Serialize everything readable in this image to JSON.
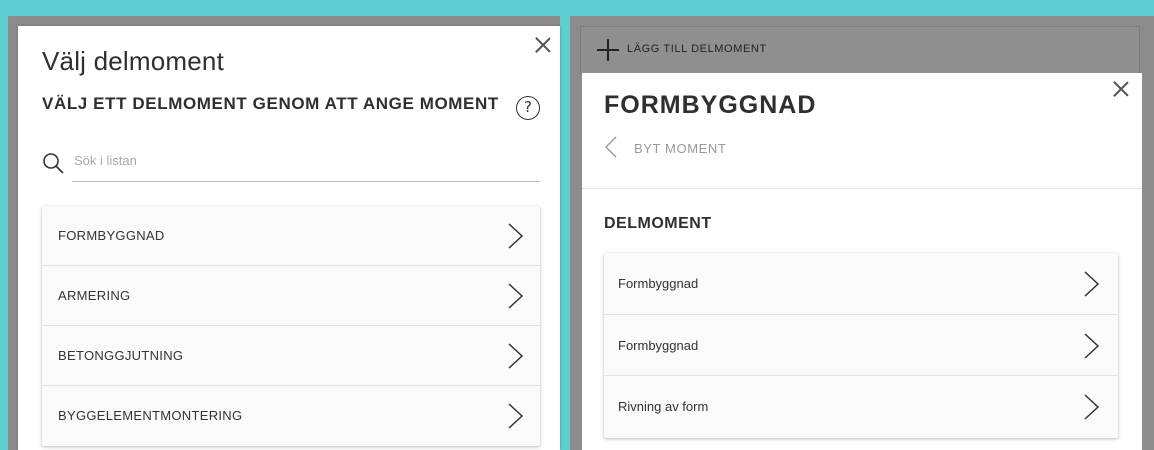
{
  "left_dialog": {
    "title": "Välj delmoment",
    "subtitle": "VÄLJ ETT DELMOMENT GENOM ATT ANGE MOMENT",
    "help_icon": "question-circle-icon",
    "search": {
      "placeholder": "Sök i listan",
      "value": ""
    },
    "items": [
      {
        "label": "FORMBYGGNAD"
      },
      {
        "label": "ARMERING"
      },
      {
        "label": "BETONGGJUTNING"
      },
      {
        "label": "BYGGELEMENTMONTERING"
      }
    ]
  },
  "right_panel": {
    "add_button_label": "LÄGG TILL DELMOMENT",
    "dialog": {
      "title": "FORMBYGGNAD",
      "back_label": "BYT MOMENT",
      "section_title": "DELMOMENT",
      "items": [
        {
          "label": "Formbyggnad"
        },
        {
          "label": "Formbyggnad"
        },
        {
          "label": "Rivning av form"
        }
      ]
    }
  },
  "colors": {
    "frame": "#5ecfd0",
    "overlay": "#8c8c8c",
    "dialog_bg": "#ffffff",
    "list_bg": "#fafafa",
    "muted_text": "#999999"
  }
}
